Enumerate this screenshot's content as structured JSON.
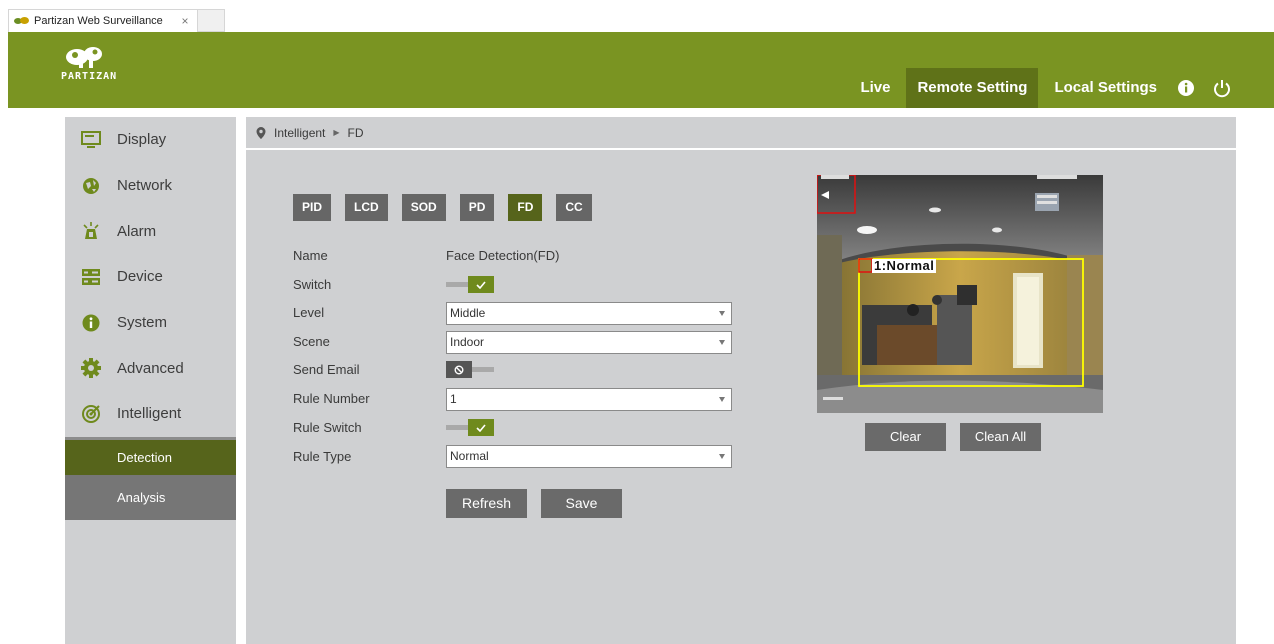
{
  "browser": {
    "tab_title": "Partizan Web Surveillance",
    "tab_close": "×"
  },
  "header": {
    "logo_text": "PARTIZAN",
    "nav": {
      "live": "Live",
      "remote_setting": "Remote Setting",
      "local_settings": "Local Settings"
    }
  },
  "sidebar": {
    "items": [
      {
        "label": "Display",
        "icon": "monitor-icon"
      },
      {
        "label": "Network",
        "icon": "globe-icon"
      },
      {
        "label": "Alarm",
        "icon": "alarm-icon"
      },
      {
        "label": "Device",
        "icon": "device-icon"
      },
      {
        "label": "System",
        "icon": "info-icon"
      },
      {
        "label": "Advanced",
        "icon": "gear-icon"
      },
      {
        "label": "Intelligent",
        "icon": "target-icon"
      }
    ],
    "sub_items": [
      {
        "label": "Detection",
        "active": true
      },
      {
        "label": "Analysis",
        "active": false
      }
    ]
  },
  "breadcrumb": {
    "parent": "Intelligent",
    "current": "FD"
  },
  "function_tabs": [
    {
      "label": "PID",
      "active": false
    },
    {
      "label": "LCD",
      "active": false
    },
    {
      "label": "SOD",
      "active": false
    },
    {
      "label": "PD",
      "active": false
    },
    {
      "label": "FD",
      "active": true
    },
    {
      "label": "CC",
      "active": false
    }
  ],
  "form": {
    "name_label": "Name",
    "name_value": "Face Detection(FD)",
    "switch_label": "Switch",
    "switch_on": true,
    "level_label": "Level",
    "level_value": "Middle",
    "scene_label": "Scene",
    "scene_value": "Indoor",
    "send_email_label": "Send Email",
    "send_email_on": false,
    "rule_number_label": "Rule Number",
    "rule_number_value": "1",
    "rule_switch_label": "Rule Switch",
    "rule_switch_on": true,
    "rule_type_label": "Rule Type",
    "rule_type_value": "Normal"
  },
  "buttons": {
    "refresh": "Refresh",
    "save": "Save",
    "clear": "Clear",
    "clean_all": "Clean All"
  },
  "preview": {
    "rule_overlay_label": "1:Normal",
    "rule_box_color": "#ffff00",
    "marker_color": "#e01010"
  },
  "colors": {
    "brand": "#7a9422",
    "active_dark": "#56641b"
  }
}
